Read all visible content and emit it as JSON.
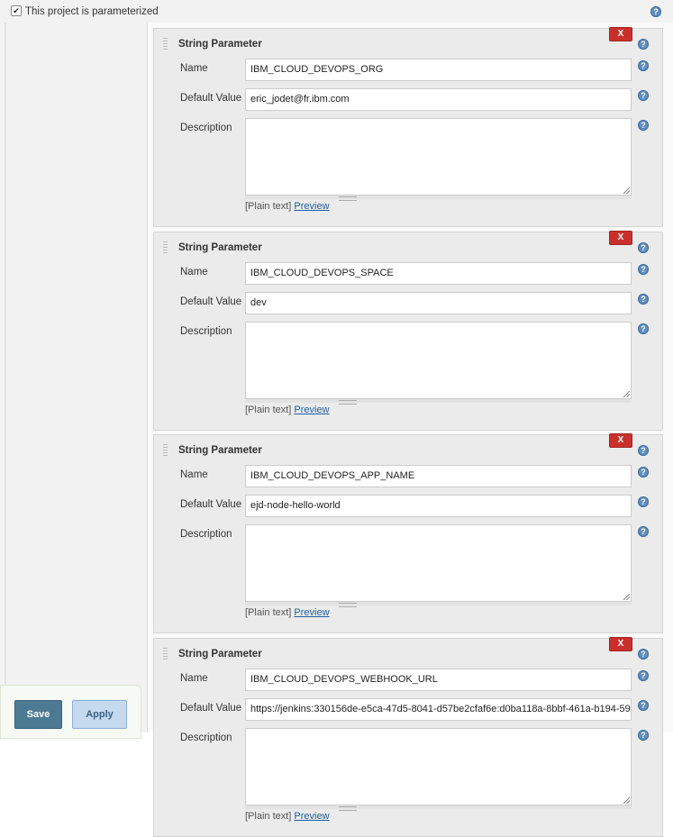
{
  "header": {
    "checkbox_label": "This project is parameterized",
    "checked": true,
    "checkbox_mark": "✔"
  },
  "help_glyph": "?",
  "parameters": [
    {
      "title": "String Parameter",
      "delete_label": "X",
      "name_label": "Name",
      "name_value": "IBM_CLOUD_DEVOPS_ORG",
      "default_label": "Default Value",
      "default_value": "eric_jodet@fr.ibm.com",
      "description_label": "Description",
      "description_value": "",
      "format_label": "[Plain text]",
      "preview_link": "Preview"
    },
    {
      "title": "String Parameter",
      "delete_label": "X",
      "name_label": "Name",
      "name_value": "IBM_CLOUD_DEVOPS_SPACE",
      "default_label": "Default Value",
      "default_value": "dev",
      "description_label": "Description",
      "description_value": "",
      "format_label": "[Plain text]",
      "preview_link": "Preview"
    },
    {
      "title": "String Parameter",
      "delete_label": "X",
      "name_label": "Name",
      "name_value": "IBM_CLOUD_DEVOPS_APP_NAME",
      "default_label": "Default Value",
      "default_value": "ejd-node-hello-world",
      "description_label": "Description",
      "description_value": "",
      "format_label": "[Plain text]",
      "preview_link": "Preview"
    },
    {
      "title": "String Parameter",
      "delete_label": "X",
      "name_label": "Name",
      "name_value": "IBM_CLOUD_DEVOPS_WEBHOOK_URL",
      "default_label": "Default Value",
      "default_value": "https://jenkins:330156de-e5ca-47d5-8041-d57be2cfaf6e:d0ba118a-8bbf-461a-b194-59",
      "description_label": "Description",
      "description_value": "",
      "format_label": "[Plain text]",
      "preview_link": "Preview"
    }
  ],
  "actions": {
    "save_label": "Save",
    "apply_label": "Apply"
  },
  "icons": {
    "help": "help-icon",
    "grip": "drag-handle-icon",
    "delete": "delete-icon",
    "checkbox": "checkbox-icon"
  },
  "colors": {
    "delete": "#c9302c",
    "save": "#4d7a93",
    "apply": "#c5d9ef",
    "link": "#1f5fa8",
    "help": "#5f8fc0"
  }
}
